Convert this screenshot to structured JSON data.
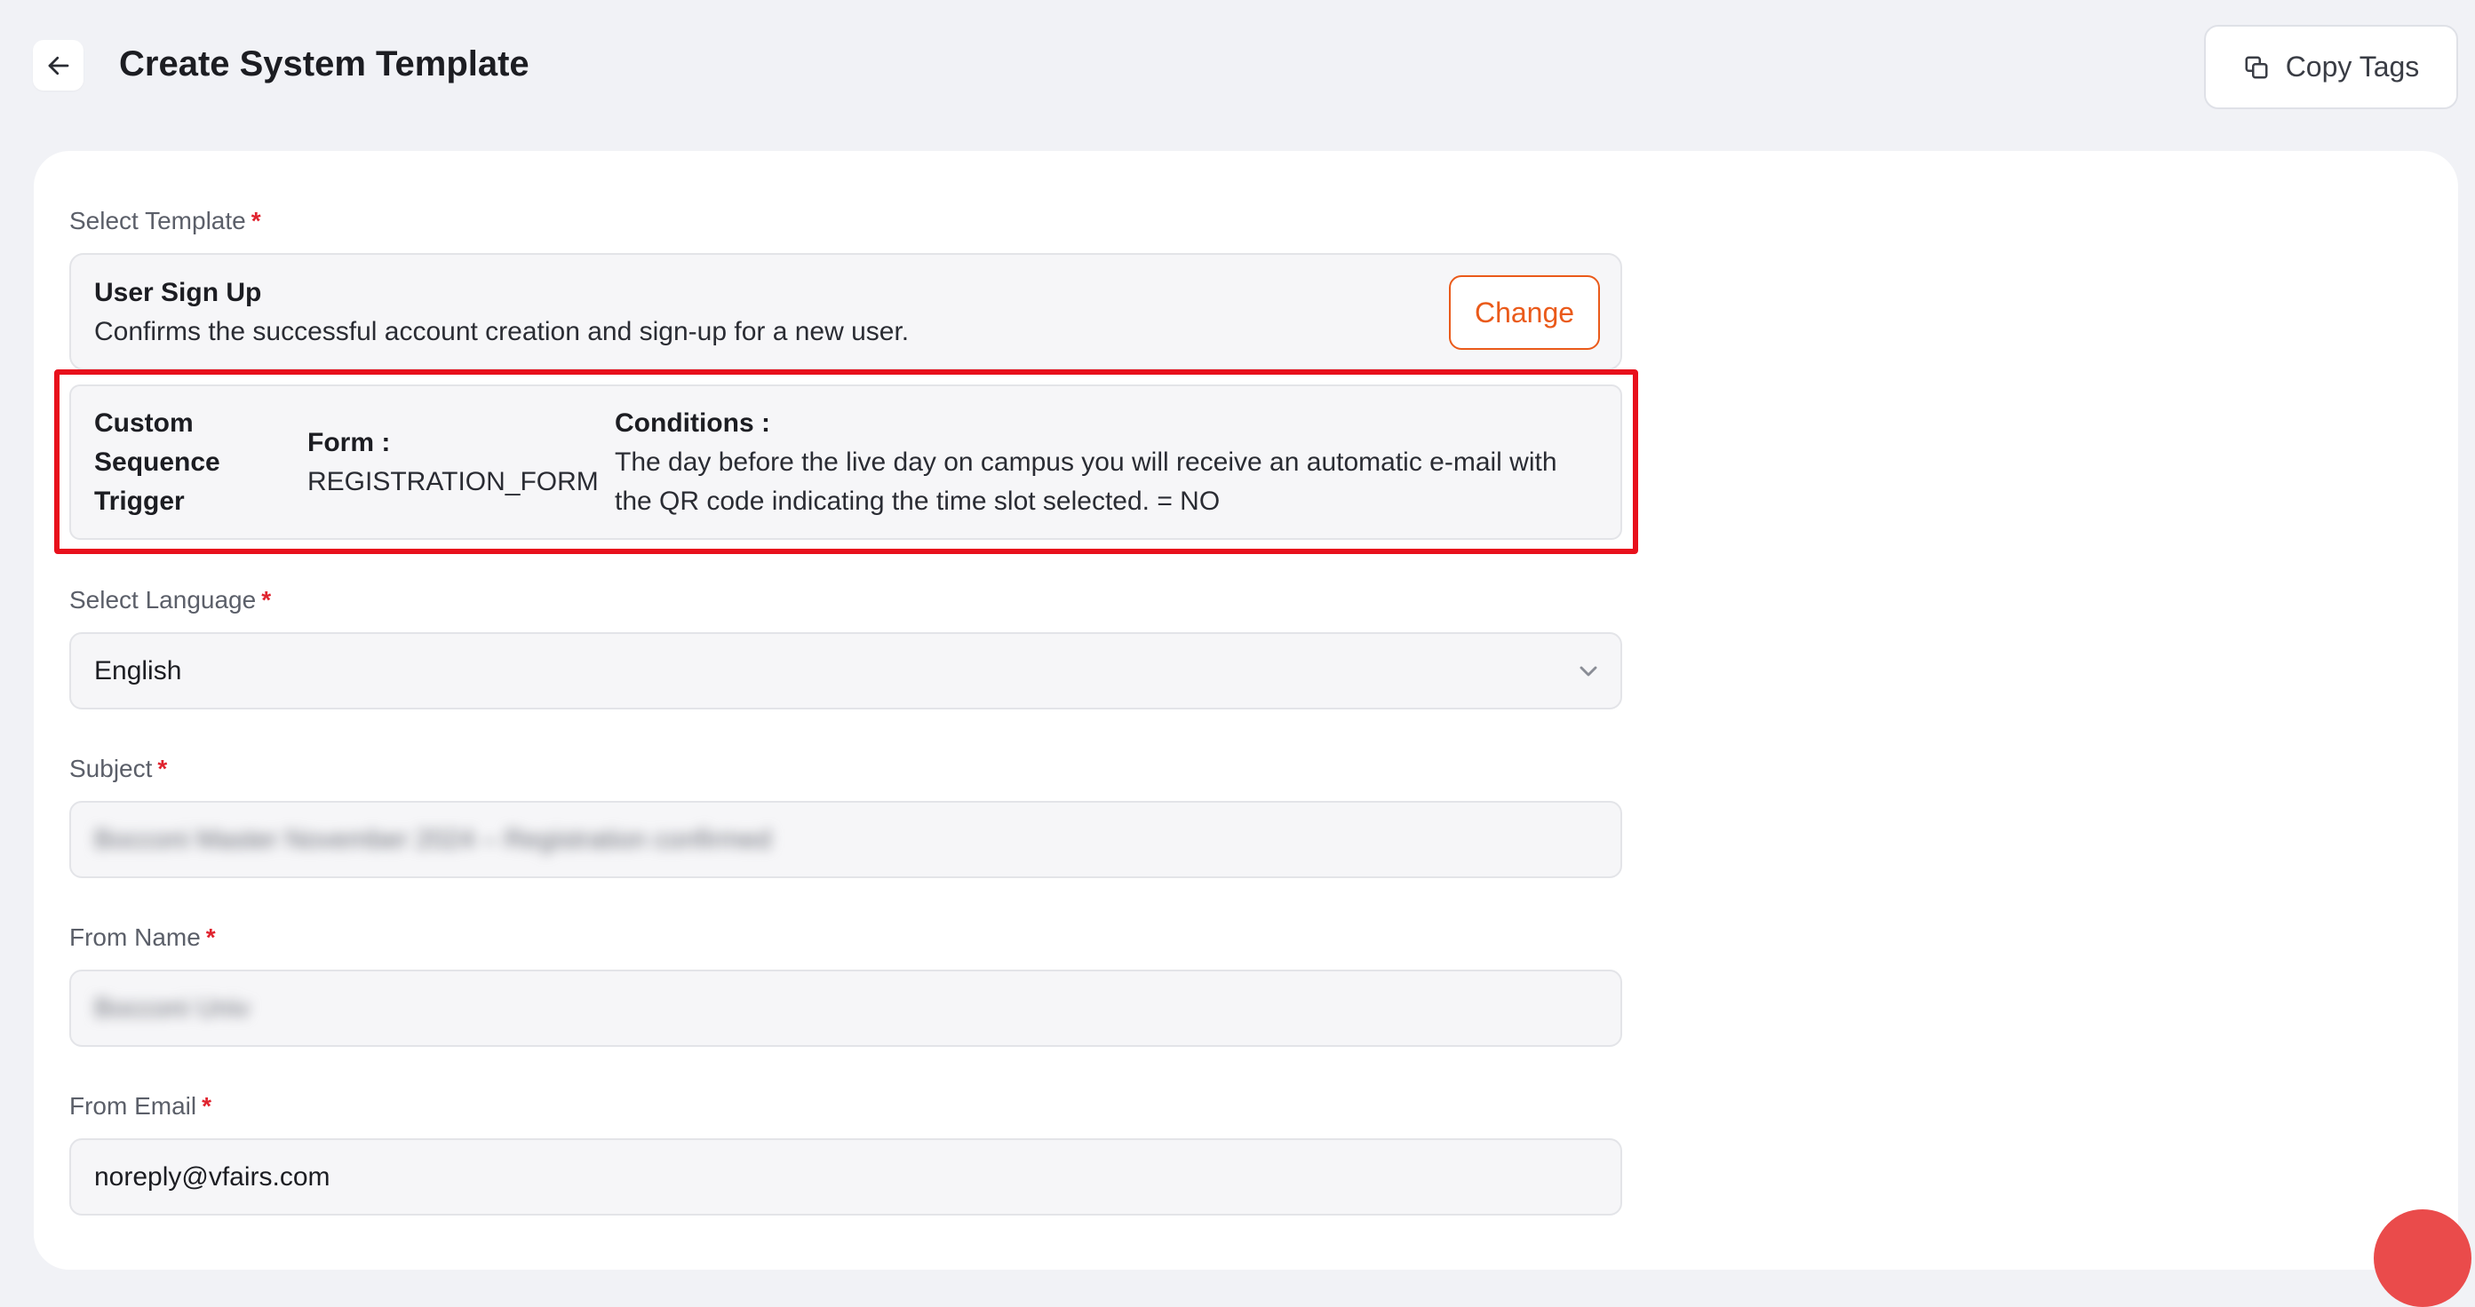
{
  "header": {
    "title": "Create System Template",
    "copy_tags_label": "Copy Tags"
  },
  "template": {
    "label": "Select Template",
    "required_mark": "*",
    "name": "User Sign Up",
    "description": "Confirms the successful account creation and sign-up for a new user.",
    "change_label": "Change"
  },
  "trigger": {
    "title": "Custom Sequence Trigger",
    "form_label": "Form :",
    "form_value": "REGISTRATION_FORM",
    "conditions_label": "Conditions :",
    "conditions_value": "The day before the live day on campus you will receive an automatic e-mail with the QR code indicating the time slot selected. = NO"
  },
  "language": {
    "label": "Select Language",
    "required_mark": "*",
    "value": "English"
  },
  "subject": {
    "label": "Subject",
    "required_mark": "*",
    "value": "Bocconi Master November 2024 – Registration confirmed"
  },
  "from_name": {
    "label": "From Name",
    "required_mark": "*",
    "value": "Bocconi Univ"
  },
  "from_email": {
    "label": "From Email",
    "required_mark": "*",
    "value": "noreply@vfairs.com"
  },
  "colors": {
    "accent": "#ea5a1a",
    "required": "#e0232e",
    "highlight": "#e8101c",
    "background": "#f1f2f6"
  },
  "icons": {
    "back": "arrow-left-icon",
    "copy": "copy-icon",
    "dropdown": "chevron-down-icon"
  }
}
